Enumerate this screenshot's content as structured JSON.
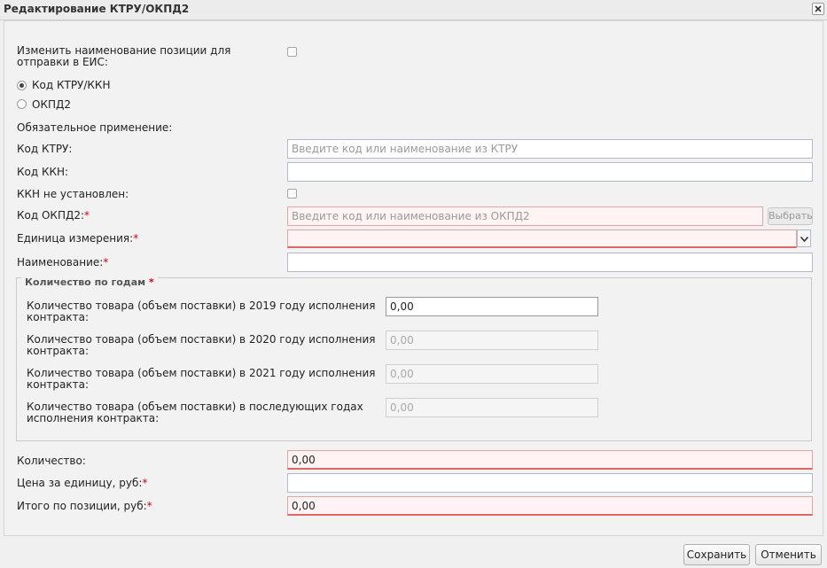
{
  "dialog": {
    "title": "Редактирование КТРУ/ОКПД2"
  },
  "form": {
    "rename_label": "Изменить наименование позиции для отправки в ЕИС:",
    "radio_ktru": "Код КТРУ/ККН",
    "radio_okpd": "ОКПД2",
    "mandatory_label": "Обязательное применение:",
    "ktru_label": "Код КТРУ:",
    "ktru_placeholder": "Введите код или наименование из КТРУ",
    "kkn_label": "Код ККН:",
    "kkn_value": "",
    "kkn_not_set_label": "ККН не установлен:",
    "okpd_label": "Код ОКПД2:",
    "okpd_placeholder": "Введите код или наименование из ОКПД2",
    "okpd_button": "Выбрать",
    "unit_label": "Единица измерения:",
    "unit_value": "",
    "name_label": "Наименование:",
    "name_value": "",
    "required_mark": "*"
  },
  "years": {
    "legend": "Количество по годам",
    "rows": [
      {
        "label": "Количество товара (объем поставки) в 2019 году исполнения контракта:",
        "value": "0,00"
      },
      {
        "label": "Количество товара (объем поставки) в 2020 году исполнения контракта:",
        "value": "0,00"
      },
      {
        "label": "Количество товара (объем поставки) в 2021 году исполнения контракта:",
        "value": "0,00"
      },
      {
        "label": "Количество товара (объем поставки) в последующих годах исполнения контракта:",
        "value": "0,00"
      }
    ]
  },
  "totals": {
    "quantity_label": "Количество:",
    "quantity_value": "0,00",
    "price_label": "Цена за единицу, руб:",
    "price_value": "",
    "total_label": "Итого по позиции, руб:",
    "total_value": "0,00"
  },
  "footer": {
    "save": "Сохранить",
    "cancel": "Отменить"
  },
  "icons": {
    "close": "close-icon",
    "dropdown": "chevron-down-icon"
  },
  "colors": {
    "required": "#d0021b",
    "invalid_border": "#e06666",
    "invalid_fill": "#fff3f3"
  }
}
